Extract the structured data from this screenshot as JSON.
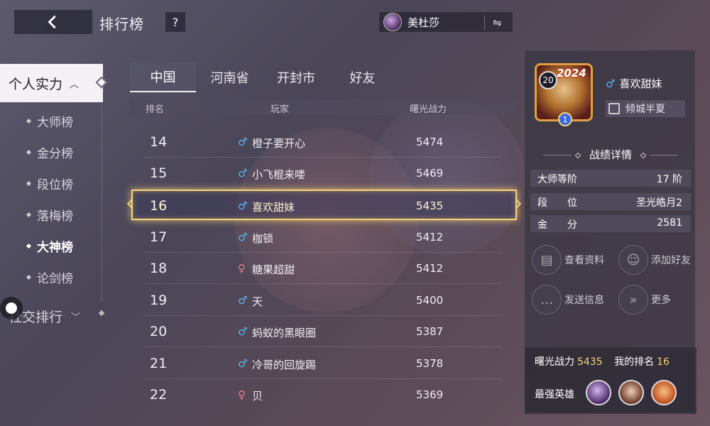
{
  "header": {
    "title": "排行榜",
    "help_label": "?",
    "hero_name": "美杜莎",
    "swap_icon": "⇋"
  },
  "nav": {
    "group_active": "个人实力",
    "items": [
      "大师榜",
      "金分榜",
      "段位榜",
      "落梅榜",
      "大神榜",
      "论剑榜"
    ],
    "active_item": "大神榜",
    "group2": "社交排行"
  },
  "tabs": [
    "中国",
    "河南省",
    "开封市",
    "好友"
  ],
  "active_tab": "中国",
  "table": {
    "columns": [
      "排名",
      "玩家",
      "曙光战力"
    ],
    "rows": [
      {
        "rank": "14",
        "gender": "male",
        "name": "橙子要开心",
        "power": "5474"
      },
      {
        "rank": "15",
        "gender": "male",
        "name": "小飞棍来喽",
        "power": "5469"
      },
      {
        "rank": "16",
        "gender": "male",
        "name": "喜欢甜妹",
        "power": "5435",
        "highlighted": true
      },
      {
        "rank": "17",
        "gender": "male",
        "name": "枷锁",
        "power": "5412"
      },
      {
        "rank": "18",
        "gender": "female",
        "name": "糖果超甜",
        "power": "5412"
      },
      {
        "rank": "19",
        "gender": "male",
        "name": "天",
        "power": "5400"
      },
      {
        "rank": "20",
        "gender": "male",
        "name": "蚂蚁的黑眼圈",
        "power": "5387"
      },
      {
        "rank": "21",
        "gender": "male",
        "name": "冷哥的回旋踢",
        "power": "5378"
      },
      {
        "rank": "22",
        "gender": "female",
        "name": "贝",
        "power": "5369"
      }
    ]
  },
  "player": {
    "level": "20",
    "year_badge": "2024",
    "rank_badge": "1",
    "name": "喜欢甜妹",
    "guild": "倾城半夏",
    "section_title": "战绩详情",
    "stats": [
      {
        "key": "大师等阶",
        "value": "17 阶"
      },
      {
        "key": "段　　位",
        "value": "圣光皓月2"
      },
      {
        "key": "金　　分",
        "value": "2581"
      }
    ],
    "actions": [
      "查看资料",
      "添加好友",
      "发送信息",
      "更多"
    ],
    "power_label": "曙光战力",
    "power_value": "5435",
    "my_rank_label": "我的排名",
    "my_rank_value": "16",
    "strongest_label": "最强英雄"
  },
  "colors": {
    "highlight_border": "#f4d47a",
    "male": "#5ab4f0",
    "female": "#f07a8a"
  }
}
